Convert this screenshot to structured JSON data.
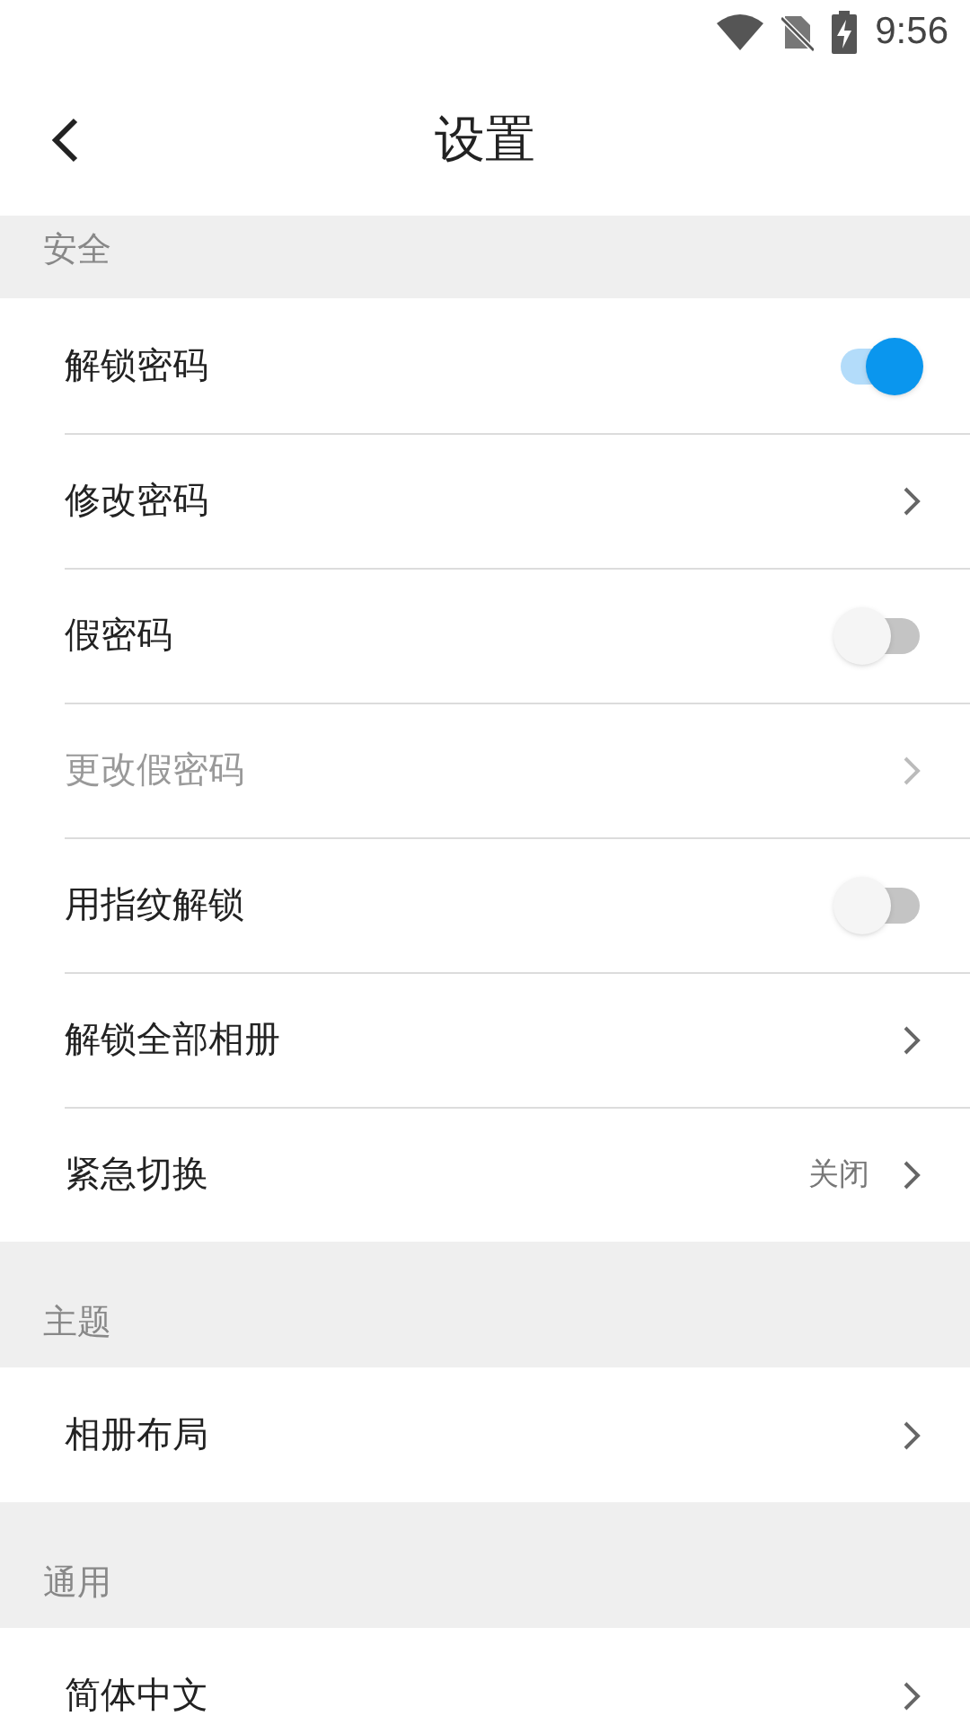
{
  "status_bar": {
    "time": "9:56"
  },
  "header": {
    "title": "设置"
  },
  "sections": [
    {
      "title": "安全",
      "items": [
        {
          "kind": "toggle",
          "label": "解锁密码",
          "on": true,
          "disabled": false
        },
        {
          "kind": "link",
          "label": "修改密码",
          "disabled": false
        },
        {
          "kind": "toggle",
          "label": "假密码",
          "on": false,
          "disabled": false
        },
        {
          "kind": "link",
          "label": "更改假密码",
          "disabled": true
        },
        {
          "kind": "toggle",
          "label": "用指纹解锁",
          "on": false,
          "disabled": false
        },
        {
          "kind": "link",
          "label": "解锁全部相册",
          "disabled": false
        },
        {
          "kind": "link",
          "label": "紧急切换",
          "value": "关闭",
          "disabled": false
        }
      ]
    },
    {
      "title": "主题",
      "items": [
        {
          "kind": "link",
          "label": "相册布局",
          "disabled": false
        }
      ]
    },
    {
      "title": "通用",
      "items": [
        {
          "kind": "link",
          "label": "简体中文",
          "disabled": false
        }
      ]
    }
  ]
}
